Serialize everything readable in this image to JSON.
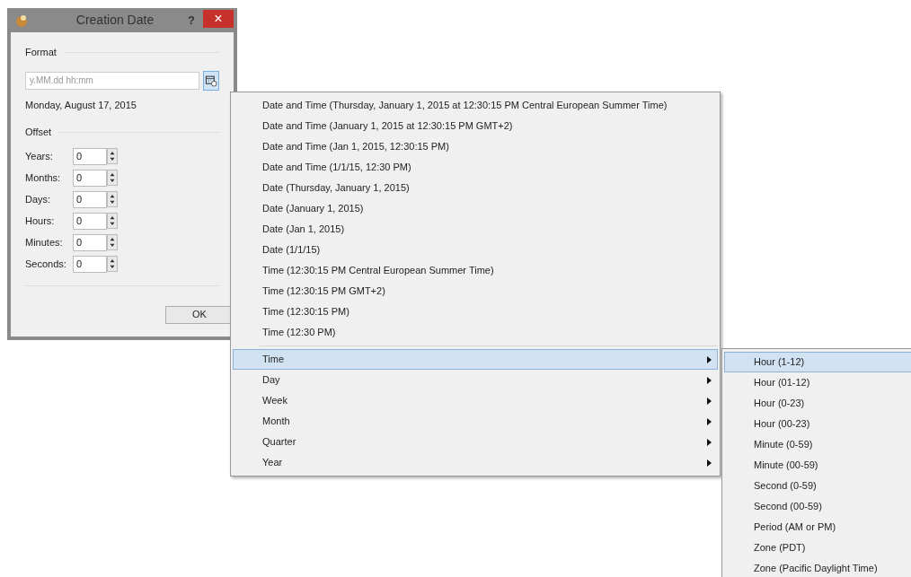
{
  "dialog": {
    "title": "Creation Date",
    "help": "?",
    "close": "×",
    "format": {
      "label": "Format",
      "placeholder": "y.MM.dd hh:mm",
      "preview": "Monday, August 17, 2015"
    },
    "offset": {
      "label": "Offset",
      "fields": [
        {
          "label": "Years:",
          "value": "0"
        },
        {
          "label": "Months:",
          "value": "0"
        },
        {
          "label": "Days:",
          "value": "0"
        },
        {
          "label": "Hours:",
          "value": "0"
        },
        {
          "label": "Minutes:",
          "value": "0"
        },
        {
          "label": "Seconds:",
          "value": "0"
        }
      ]
    },
    "ok": "OK"
  },
  "menu": {
    "items": [
      {
        "kind": "item",
        "label": "Date and Time (Thursday, January 1, 2015 at 12:30:15 PM Central European Summer Time)",
        "selected": false
      },
      {
        "kind": "item",
        "label": "Date and Time (January 1, 2015 at 12:30:15 PM GMT+2)",
        "selected": false
      },
      {
        "kind": "item",
        "label": "Date and Time (Jan 1, 2015, 12:30:15 PM)",
        "selected": false
      },
      {
        "kind": "item",
        "label": "Date and Time (1/1/15, 12:30 PM)",
        "selected": false
      },
      {
        "kind": "item",
        "label": "Date (Thursday, January 1, 2015)",
        "selected": false
      },
      {
        "kind": "item",
        "label": "Date (January 1, 2015)",
        "selected": false
      },
      {
        "kind": "item",
        "label": "Date (Jan 1, 2015)",
        "selected": false
      },
      {
        "kind": "item",
        "label": "Date (1/1/15)",
        "selected": false
      },
      {
        "kind": "item",
        "label": "Time (12:30:15 PM Central European Summer Time)",
        "selected": false
      },
      {
        "kind": "item",
        "label": "Time (12:30:15 PM GMT+2)",
        "selected": false
      },
      {
        "kind": "item",
        "label": "Time (12:30:15 PM)",
        "selected": false
      },
      {
        "kind": "item",
        "label": "Time (12:30 PM)",
        "selected": false
      },
      {
        "kind": "separator"
      },
      {
        "kind": "submenu",
        "label": "Time",
        "selected": true
      },
      {
        "kind": "submenu",
        "label": "Day",
        "selected": false
      },
      {
        "kind": "submenu",
        "label": "Week",
        "selected": false
      },
      {
        "kind": "submenu",
        "label": "Month",
        "selected": false
      },
      {
        "kind": "submenu",
        "label": "Quarter",
        "selected": false
      },
      {
        "kind": "submenu",
        "label": "Year",
        "selected": false
      }
    ]
  },
  "submenu": {
    "items": [
      {
        "label": "Hour (1-12)",
        "selected": true
      },
      {
        "label": "Hour (01-12)",
        "selected": false
      },
      {
        "label": "Hour (0-23)",
        "selected": false
      },
      {
        "label": "Hour (00-23)",
        "selected": false
      },
      {
        "label": "Minute (0-59)",
        "selected": false
      },
      {
        "label": "Minute (00-59)",
        "selected": false
      },
      {
        "label": "Second (0-59)",
        "selected": false
      },
      {
        "label": "Second (00-59)",
        "selected": false
      },
      {
        "label": "Period (AM or PM)",
        "selected": false
      },
      {
        "label": "Zone (PDT)",
        "selected": false
      },
      {
        "label": "Zone (Pacific Daylight Time)",
        "selected": false
      }
    ]
  }
}
